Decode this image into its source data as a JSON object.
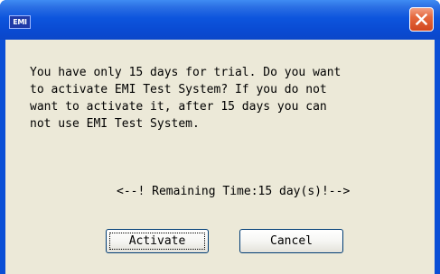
{
  "window": {
    "app_icon_text": "EMI",
    "close_icon": "close-icon"
  },
  "dialog": {
    "message": "You have only 15 days for trial. Do you want\nto activate EMI Test System? If you do not\nwant to activate it, after 15 days you can\nnot use EMI Test System.",
    "remaining": "<--! Remaining Time:15 day(s)!-->"
  },
  "buttons": {
    "activate_label": "Activate",
    "cancel_label": "Cancel"
  },
  "colors": {
    "titlebar": "#0a4bd3",
    "close_button": "#e5683d",
    "client_background": "#ece9d8"
  }
}
